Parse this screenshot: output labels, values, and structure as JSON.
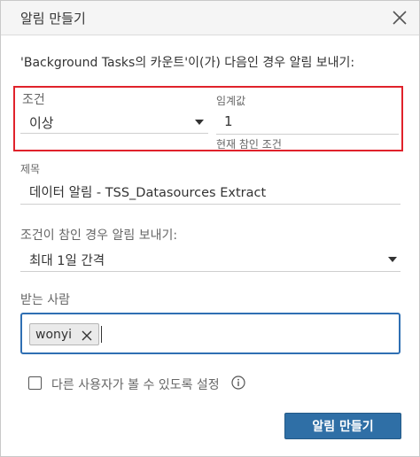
{
  "dialog": {
    "title": "알림 만들기",
    "prompt": "'Background Tasks의 카운트'이(가) 다음인 경우 알림 보내기:"
  },
  "condition": {
    "label": "조건",
    "value": "이상",
    "threshold_label": "임계값",
    "threshold_value": "1",
    "status_text": "현재 참인 조건"
  },
  "subject": {
    "label": "제목",
    "value": "데이터 알림 - TSS_Datasources Extract"
  },
  "frequency": {
    "label": "조건이 참인 경우 알림 보내기:",
    "value": "최대 1일 간격"
  },
  "recipients": {
    "label": "받는 사람",
    "chips": [
      "wonyi"
    ]
  },
  "visibility": {
    "label": "다른 사용자가 볼 수 있도록 설정",
    "checked": false
  },
  "actions": {
    "create_label": "알림 만들기"
  },
  "colors": {
    "highlight_border": "#e0222b",
    "primary_button": "#2f6fa6",
    "focus_border": "#2f6fb3"
  }
}
